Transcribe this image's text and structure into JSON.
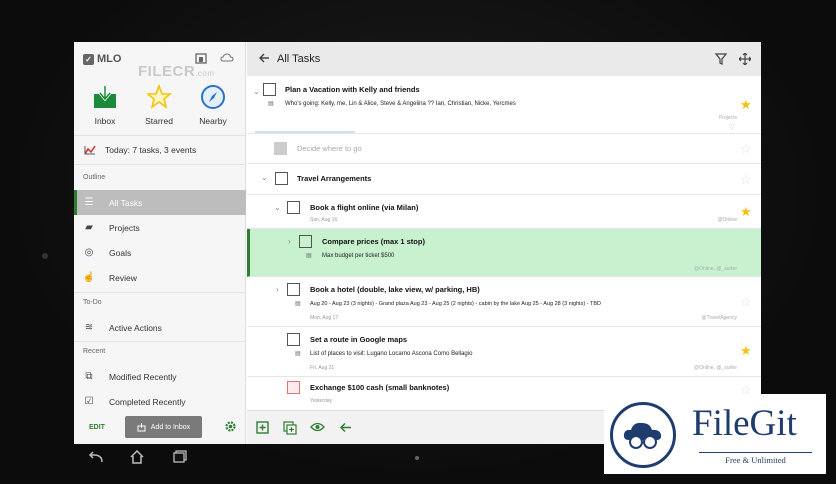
{
  "sidebar": {
    "app_name": "MLO",
    "watermark": "FILECR",
    "watermark_suffix": ".com",
    "quick": [
      {
        "label": "Inbox"
      },
      {
        "label": "Starred"
      },
      {
        "label": "Nearby"
      }
    ],
    "today": "Today: 7 tasks, 3 events",
    "section_outline": "Outline",
    "outline_items": [
      "All Tasks",
      "Projects",
      "Goals",
      "Review"
    ],
    "section_todo": "To-Do",
    "todo_items": [
      "Active Actions"
    ],
    "section_recent": "Recent",
    "recent_items": [
      "Modified Recently",
      "Completed Recently"
    ],
    "edit_label": "EDIT",
    "add_inbox_label": "Add to Inbox"
  },
  "main": {
    "title": "All Tasks",
    "tasks": [
      {
        "title": "Plan a Vacation with Kelly and friends",
        "note": "Who's going: Kelly, me, Lin & Alice, Steve & Angelina ?? Ian, Christian, Nicke, Yercmes",
        "ctx": "Projects"
      },
      {
        "title": "Decide where to go"
      },
      {
        "title": "Travel Arrangements"
      },
      {
        "title": "Book a flight online (via Milan)",
        "date": "Sun, Aug 16",
        "ctx": "@Online"
      },
      {
        "title": "Compare prices (max 1 stop)",
        "note": "Max budget per ticket $500",
        "ctx": "@Online, @_surfer"
      },
      {
        "title": "Book a hotel (double, lake view, w/ parking, HB)",
        "note": "Aug 20 - Aug 23 (3 nights) - Grand plaza Aug 23 - Aug 25 (2 nights) - cabin by the lake Aug 25 - Aug 28 (3 nights) - TBD",
        "date": "Mon, Aug 17",
        "ctx": "@TravelAgency"
      },
      {
        "title": "Set a route in Google maps",
        "note": "List of places to visit: Lugano Locarno Ascona Como Bellagio",
        "date": "Fri, Aug 21",
        "ctx": "@Online, @_surfer"
      },
      {
        "title": "Exchange $100 cash (small banknotes)",
        "date": "Yesterday"
      }
    ]
  },
  "badge": {
    "name": "FileGit",
    "tagline": "Free & Unlimited"
  },
  "colors": {
    "accent": "#2e7d32",
    "highlight": "#c8f2cf",
    "star": "#f4c20d"
  }
}
